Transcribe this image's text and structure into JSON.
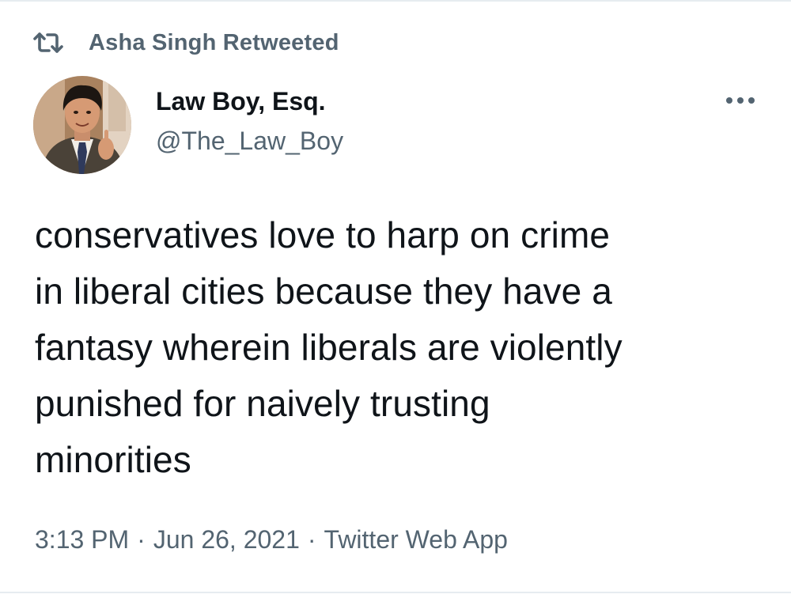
{
  "retweet": {
    "icon": "retweet-icon",
    "label": "Asha Singh Retweeted"
  },
  "author": {
    "display_name": "Law Boy, Esq.",
    "handle": "@The_Law_Boy",
    "avatar_icon": "avatar"
  },
  "more_icon": "more-horizontal-icon",
  "tweet": {
    "lines": [
      "conservatives love to harp on crime",
      "in liberal cities because they have a",
      "fantasy wherein liberals are violently",
      "punished for naively trusting",
      "minorities"
    ]
  },
  "meta": {
    "time": "3:13 PM",
    "separator": "·",
    "date": "Jun 26, 2021",
    "source": "Twitter Web App"
  },
  "colors": {
    "text_primary": "#0f1419",
    "text_secondary": "#536471",
    "divider": "#e6ecf0"
  }
}
